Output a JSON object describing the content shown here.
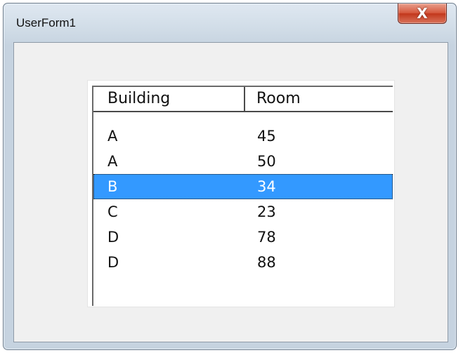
{
  "window": {
    "title": "UserForm1",
    "close_glyph": "X"
  },
  "listbox": {
    "columns": [
      "Building",
      "Room"
    ],
    "rows": [
      {
        "building": "A",
        "room": "45",
        "selected": false
      },
      {
        "building": "A",
        "room": "50",
        "selected": false
      },
      {
        "building": "B",
        "room": "34",
        "selected": true
      },
      {
        "building": "C",
        "room": "23",
        "selected": false
      },
      {
        "building": "D",
        "room": "78",
        "selected": false
      },
      {
        "building": "D",
        "room": "88",
        "selected": false
      }
    ]
  },
  "colors": {
    "selection": "#3399ff",
    "close_button": "#c2371c",
    "form_background": "#f0f0f0"
  }
}
